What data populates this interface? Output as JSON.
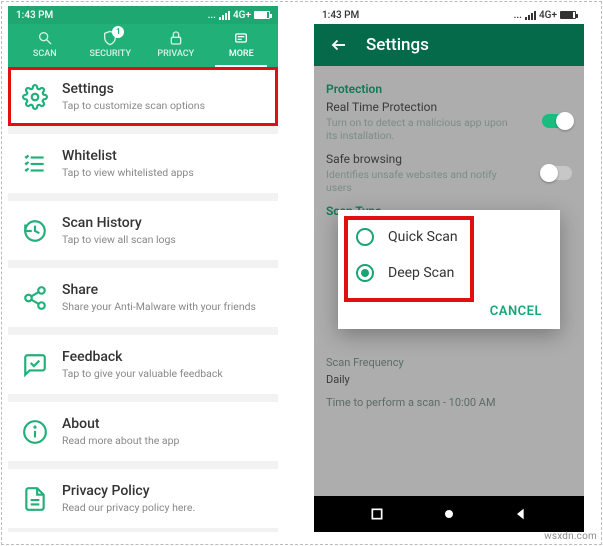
{
  "phone1": {
    "status": {
      "time": "1:43 PM",
      "net": "4G+"
    },
    "tabs": [
      "SCAN",
      "SECURITY",
      "PRIVACY",
      "MORE"
    ],
    "badge": "1",
    "items": [
      {
        "title": "Settings",
        "sub": "Tap to customize scan options"
      },
      {
        "title": "Whitelist",
        "sub": "Tap to view whitelisted apps"
      },
      {
        "title": "Scan History",
        "sub": "Tap to view all scan logs"
      },
      {
        "title": "Share",
        "sub": "Share your Anti-Malware with your friends"
      },
      {
        "title": "Feedback",
        "sub": "Tap to give your valuable feedback"
      },
      {
        "title": "About",
        "sub": "Read more about the app"
      },
      {
        "title": "Privacy Policy",
        "sub": "Read our privacy policy here."
      }
    ]
  },
  "phone2": {
    "status": {
      "time": "1:43 PM",
      "net": "4G+"
    },
    "appbar": "Settings",
    "sections": {
      "protection": {
        "title": "Protection",
        "realtime": {
          "t": "Real Time Protection",
          "s": "Turn on to detect a malicious app upon its installation."
        },
        "safebrowsing": {
          "t": "Safe browsing",
          "s": "Identifies unsafe websites and notify users"
        }
      },
      "scantype": {
        "title": "Scan Type"
      },
      "schedule": {
        "freq_label": "Scan Frequency",
        "freq_value": "Daily",
        "time_label": "Time to perform a scan - 10:00 AM"
      }
    },
    "dialog": {
      "options": [
        "Quick Scan",
        "Deep Scan"
      ],
      "cancel": "CANCEL"
    }
  },
  "watermark": "wsxdn.com"
}
